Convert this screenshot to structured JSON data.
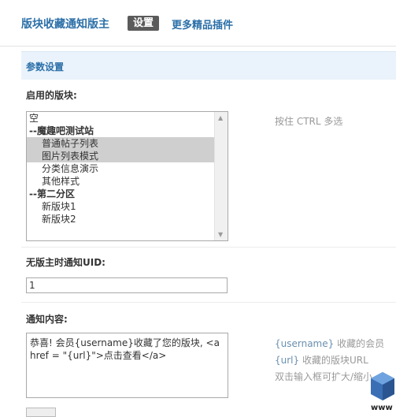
{
  "header": {
    "plugin_title": "版块收藏通知版主",
    "tabs": [
      {
        "label": "设置"
      },
      {
        "label": "更多精品插件"
      }
    ]
  },
  "section": {
    "title": "参数设置"
  },
  "forums_field": {
    "label": "启用的版块:",
    "hint": "按住 CTRL 多选",
    "options": [
      {
        "label": "空"
      },
      {
        "label": "--魔趣吧测试站"
      },
      {
        "label": "普通帖子列表"
      },
      {
        "label": "图片列表模式"
      },
      {
        "label": "分类信息演示"
      },
      {
        "label": "其他样式"
      },
      {
        "label": "--第二分区"
      },
      {
        "label": "新版块1"
      },
      {
        "label": "新版块2"
      }
    ]
  },
  "uid_field": {
    "label": "无版主时通知UID:",
    "value": "1"
  },
  "content_field": {
    "label": "通知内容:",
    "value_line1": "恭喜! 会员{username}收藏了您的版块, <a",
    "value_line2": "href = \"{url}\">点击查看</a>",
    "hint_line1_var": "{username}",
    "hint_line1_text": " 收藏的会员",
    "hint_line2_var": "{url}",
    "hint_line2_text": " 收藏的版块URL",
    "hint_line3": "双击输入框可扩大/缩小"
  },
  "watermark": {
    "text": "www"
  },
  "colors": {
    "accent": "#2b6fa8",
    "tab_active_bg": "#5b5b5b",
    "section_bg": "#eaf3fb",
    "selected_bg": "#cfcfcf"
  }
}
